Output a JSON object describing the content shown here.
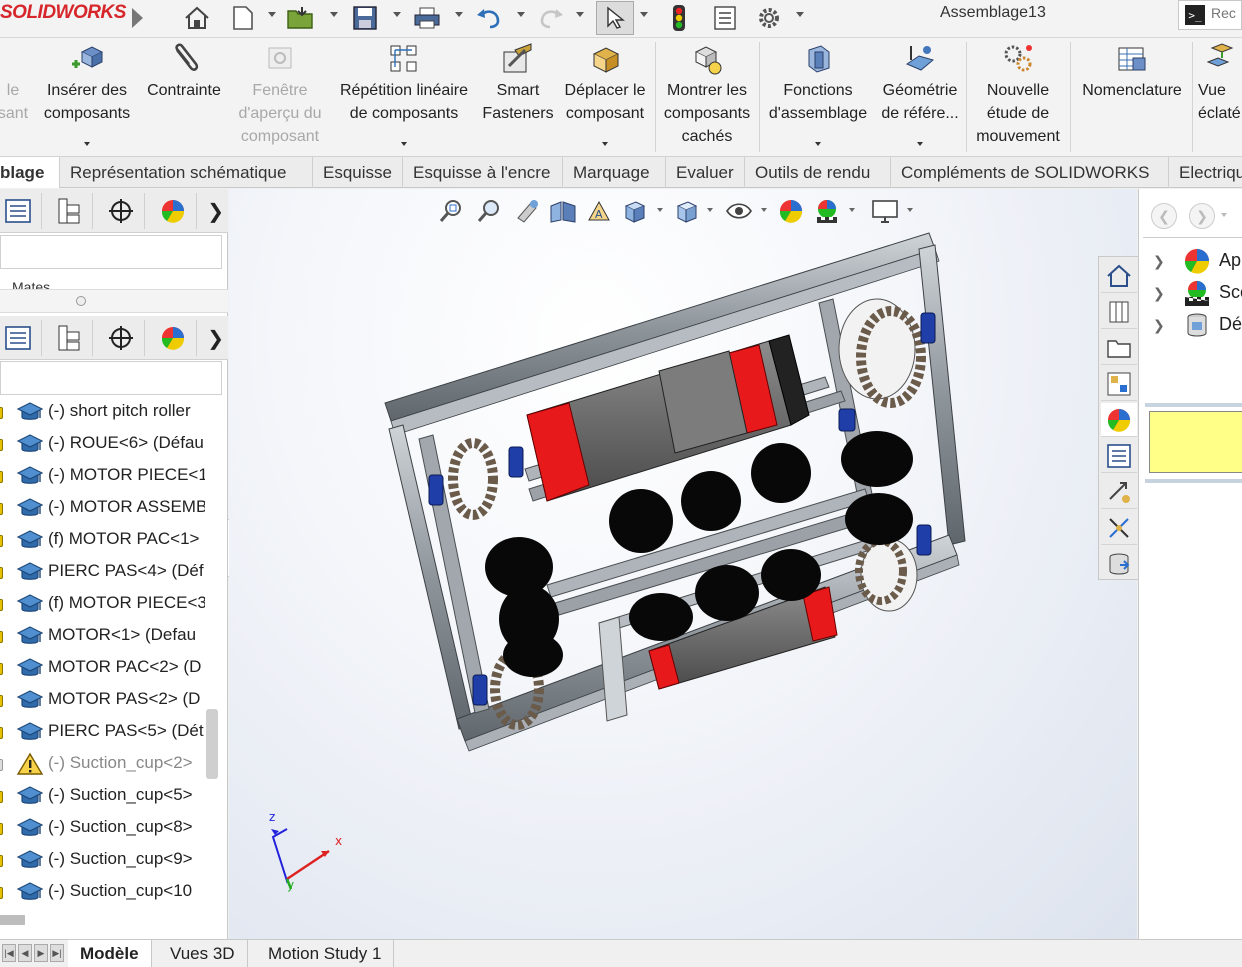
{
  "app": {
    "logo_text": "SOLIDWORKS",
    "document_title": "Assemblage13",
    "search_placeholder": "Rec"
  },
  "quick_access": [
    "home-icon",
    "new-document-icon",
    "open-icon",
    "save-icon",
    "print-icon",
    "undo-icon",
    "redo-icon",
    "select-icon",
    "rebuild-icon",
    "file-properties-icon",
    "options-icon"
  ],
  "ribbon": {
    "items": [
      {
        "label": "le\nsant",
        "disabled": true
      },
      {
        "label": "Insérer des\ncomposants",
        "has_dropdown": true
      },
      {
        "label": "Contrainte"
      },
      {
        "label": "Fenêtre\nd'aperçu du\ncomposant",
        "disabled": true
      },
      {
        "label": "Répétition linéaire\nde composants",
        "has_dropdown": true
      },
      {
        "label": "Smart\nFasteners"
      },
      {
        "label": "Déplacer le\ncomposant",
        "has_dropdown": true
      },
      {
        "label": "Montrer les\ncomposants\ncachés"
      },
      {
        "label": "Fonctions\nd'assemblage",
        "has_dropdown": true
      },
      {
        "label": "Géométrie\nde référe...",
        "has_dropdown": true
      },
      {
        "label": "Nouvelle\nétude de\nmouvement"
      },
      {
        "label": "Nomenclature"
      },
      {
        "label": "Vue\néclaté"
      }
    ]
  },
  "tabs": [
    "blage",
    "Représentation schématique",
    "Esquisse",
    "Esquisse à l'encre",
    "Marquage",
    "Evaluer",
    "Outils de rendu",
    "Compléments de SOLIDWORKS",
    "Electriqu"
  ],
  "left_panel": {
    "mates_label": "Mates",
    "tree_items": [
      {
        "label": "(-) short pitch roller",
        "status": "ok"
      },
      {
        "label": "(-) ROUE<6> (Défau",
        "status": "ok"
      },
      {
        "label": "(-) MOTOR PIECE<1",
        "status": "ok"
      },
      {
        "label": "(-) MOTOR ASSEMB",
        "status": "ok"
      },
      {
        "label": "(f) MOTOR PAC<1>",
        "status": "ok"
      },
      {
        "label": "PIERC PAS<4> (Déf",
        "status": "ok"
      },
      {
        "label": "(f) MOTOR PIECE<3",
        "status": "ok"
      },
      {
        "label": "MOTOR<1> (Defau",
        "status": "ok"
      },
      {
        "label": "MOTOR PAC<2> (D",
        "status": "ok"
      },
      {
        "label": "MOTOR PAS<2> (D",
        "status": "ok"
      },
      {
        "label": "PIERC PAS<5> (Dét",
        "status": "ok"
      },
      {
        "label": "(-) Suction_cup<2>",
        "status": "warning"
      },
      {
        "label": "(-) Suction_cup<5>",
        "status": "ok"
      },
      {
        "label": "(-) Suction_cup<8>",
        "status": "ok"
      },
      {
        "label": "(-) Suction_cup<9>",
        "status": "ok"
      },
      {
        "label": "(-) Suction_cup<10",
        "status": "ok"
      }
    ]
  },
  "bottom_tabs": [
    "Modèle",
    "Vues 3D",
    "Motion Study 1"
  ],
  "viewport": {
    "triad": {
      "x_label": "x",
      "y_label": "y",
      "z_label": "z"
    }
  },
  "right_pane": {
    "rows": [
      {
        "label": "Ap",
        "icon": "appearances-icon"
      },
      {
        "label": "Scè",
        "icon": "scenes-icon"
      },
      {
        "label": "Dé",
        "icon": "decals-icon"
      }
    ]
  },
  "colors": {
    "accent": "#3a6fb0",
    "logo_red": "#d6262b",
    "motor_red": "#e8191b",
    "frame_gray": "#9aa0a6"
  }
}
